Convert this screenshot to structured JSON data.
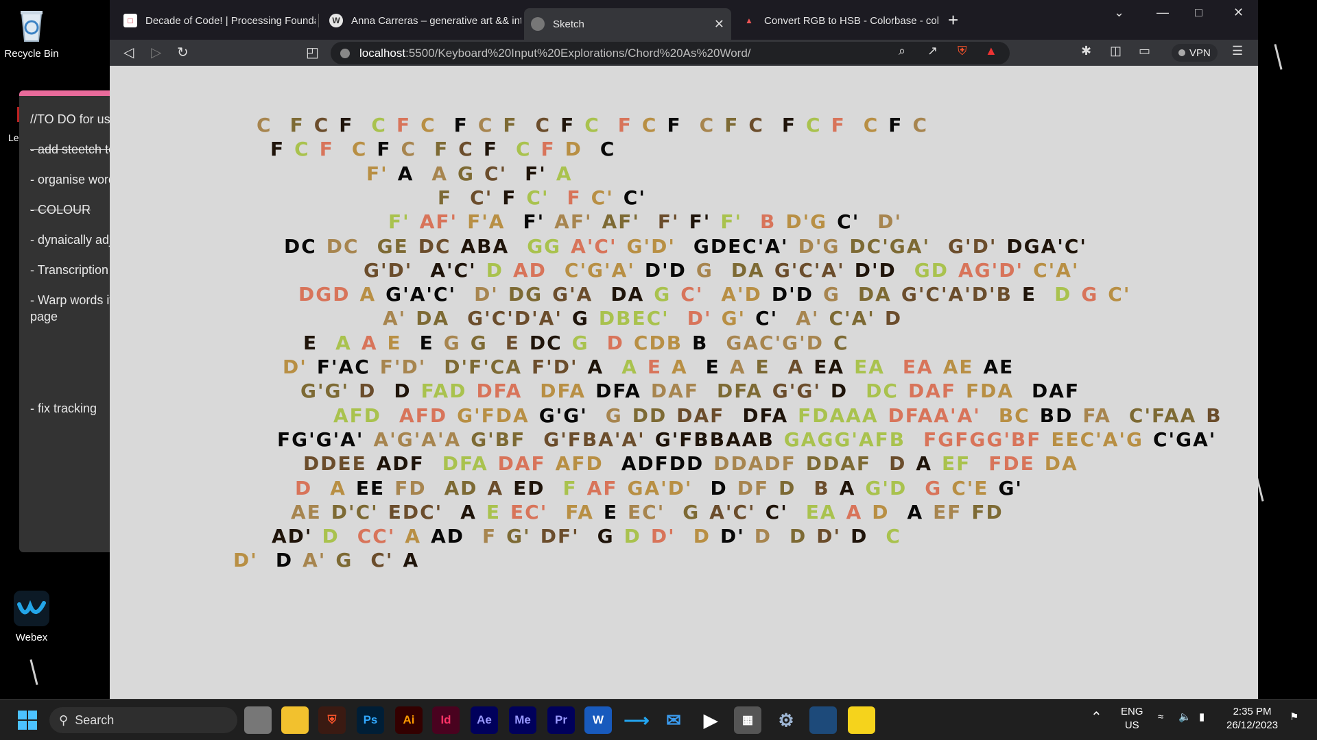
{
  "desktop": {
    "recycle_bin": "Recycle Bin",
    "webex": "Webex",
    "left_label": "Le"
  },
  "notes": {
    "items": [
      {
        "text": "//TO DO for us",
        "strike": false
      },
      {
        "text": "- add steetch te",
        "strike": true
      },
      {
        "text": "- organise word",
        "strike": false
      },
      {
        "text": "- COLOUR",
        "strike": true
      },
      {
        "text": "- dynaically adj",
        "strike": false
      },
      {
        "text": "- Transcription",
        "strike": false
      },
      {
        "text": "- Warp words it page",
        "strike": false
      },
      {
        "text": "- fix tracking",
        "strike": false
      }
    ]
  },
  "browser": {
    "tabs": [
      {
        "title": "Decade of Code! | Processing Foundat",
        "icon": "code-icon",
        "active": false
      },
      {
        "title": "Anna Carreras – generative art && int",
        "icon": "wordpress-icon",
        "active": false
      },
      {
        "title": "Sketch",
        "icon": "globe-icon",
        "active": true
      },
      {
        "title": "Convert RGB to HSB - Colorbase - col",
        "icon": "colorbase-icon",
        "active": false
      }
    ],
    "url_host": "localhost",
    "url_path": ":5500/Keyboard%20Input%20Explorations/Chord%20As%20Word/",
    "vpn_label": "VPN"
  },
  "sketch": {
    "colors": {
      "tan": "#a7854f",
      "olive": "#7d6a34",
      "brown": "#6b4d2c",
      "dark": "#1f140a",
      "green": "#a9c24e",
      "salmon": "#d8745a",
      "gold": "#b88f44",
      "black": "#080808"
    },
    "lines": [
      "C F C F C F C F C F C F C F C F C F C F C F C F C",
      "F C F C F C F C F C F D C",
      "F' A A G C' F' A",
      "F C' F C' F C' C'",
      "F' AF' F'A F' AF' AF' F' F' F' B D'G C' D'",
      "DC DC GE DC ABA GG A'C' G'D' GDEC'A' D'G DC'GA' G'D' DGA'C'",
      "G'D' A'C' D AD C'G'A' D'D G DA G'C'A' D'D GD AG'D' C'A'",
      "DGD A G'A'C' D' DG G'A DA G C' A'D D'D G DA G'C'A'D'B E D G C'",
      "A' DA G'C'D'A' G DBEC' D' G' C' A' C'A' D",
      "E A A E E G G E DC G D CDB B GAC'G'D C",
      "D' F'AC F'D' D'F'CA F'D' A A E A E A E A EA EA EA AE AE",
      "G'G' D D FAD DFA DFA DFA DAF DFA G'G' D DC DAF FDA DAF",
      "AFD AFD G'FDA G'G' G DD DAF DFA FDAAA DFAA'A' BC BD FA C'FAA B",
      "FG'G'A' A'G'A'A G'BF G'FBA'A' G'FBBAAB GAGG'AFB FGFGG'BF EEC'A'G C'GA'",
      "DDEE ADF DFA DAF AFD ADFDD DDADF DDAF D A EF FDE DA",
      "D A EE FD AD A ED F AF GA'D' D DF D B A G'D G C'E G'",
      "AE D'C' EDC' A E EC' FA E EC' G A'C' C' EA A D A EF FD",
      "AD' D CC' A AD F G' DF' G D D' D D' D D D' D C",
      "D' D A' G C' A"
    ]
  }
}
